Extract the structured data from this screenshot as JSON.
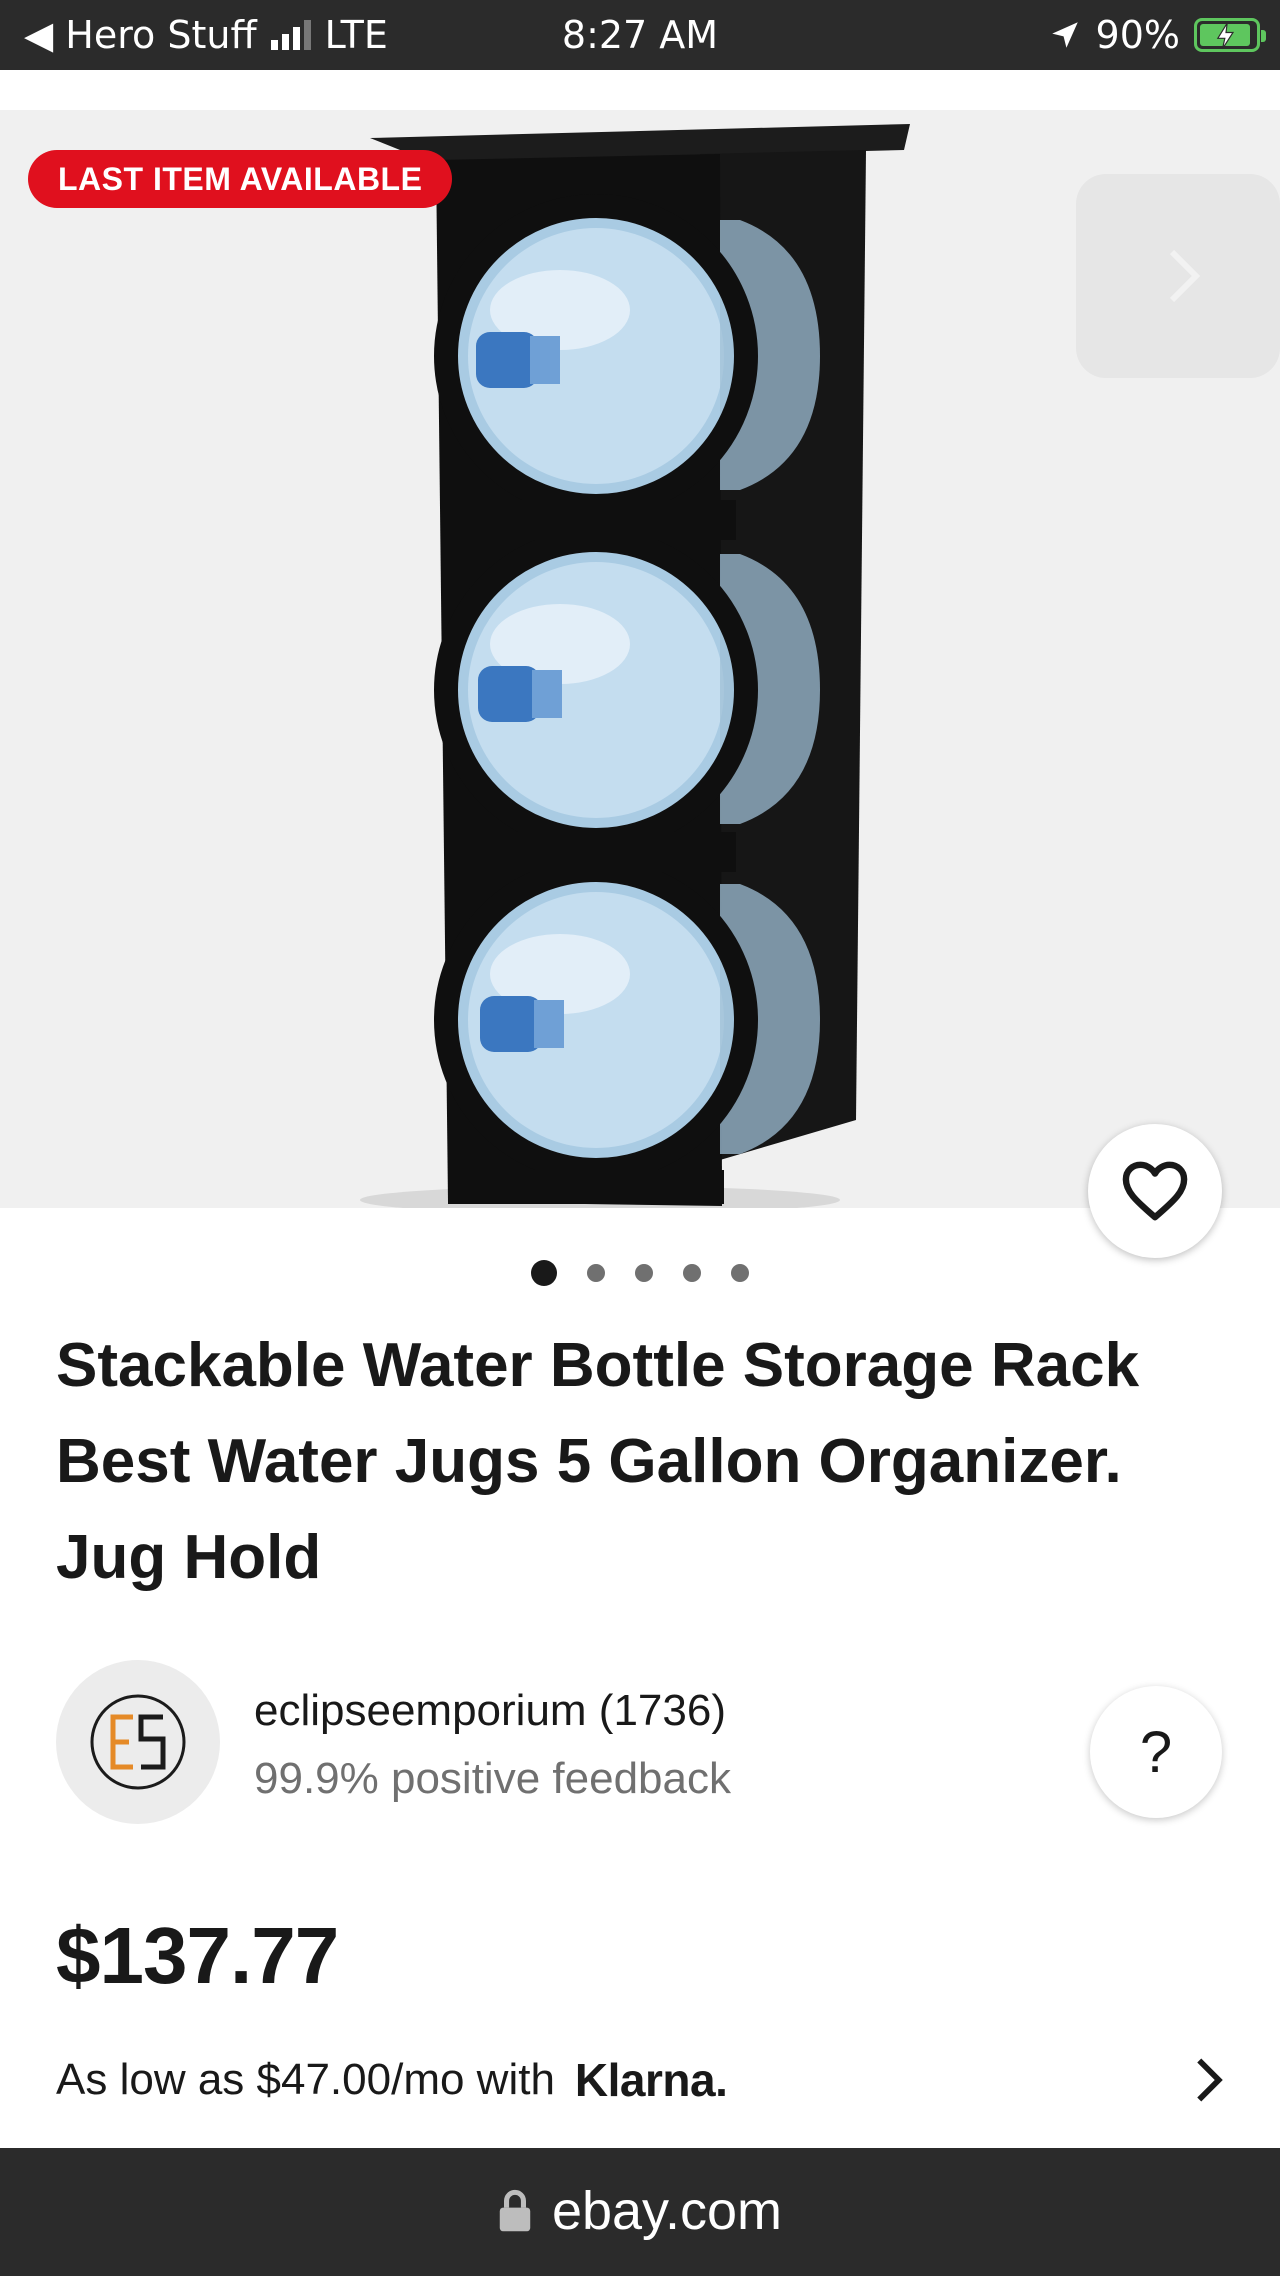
{
  "status_bar": {
    "back_label": "◀ Hero Stuff",
    "network": "LTE",
    "time": "8:27 AM",
    "battery": "90%"
  },
  "gallery": {
    "badge": "LAST ITEM AVAILABLE",
    "image_count": 5,
    "active_index": 0
  },
  "listing": {
    "title": "Stackable Water Bottle Storage Rack Best Water Jugs 5 Gallon Organizer. Jug Hold",
    "price": "$137.77"
  },
  "seller": {
    "avatar_text": "EE",
    "name": "eclipseemporium (1736)",
    "feedback": "99.9% positive feedback",
    "help_label": "?"
  },
  "financing": {
    "text": "As low as $47.00/mo with",
    "provider": "Klarna."
  },
  "browser": {
    "url": "ebay.com"
  },
  "colors": {
    "badge_red": "#e0101e",
    "text_primary": "#191919",
    "text_secondary": "#707070",
    "bar_dark": "#2b2b2b",
    "battery_green": "#5ec65e"
  }
}
